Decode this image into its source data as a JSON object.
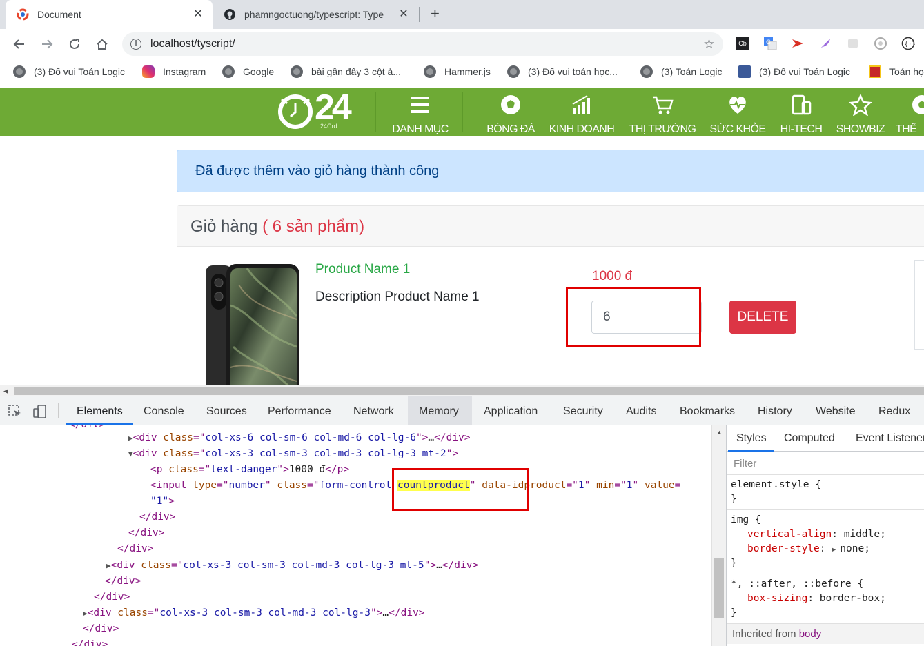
{
  "browser": {
    "tabs": [
      {
        "title": "Document",
        "active": true
      },
      {
        "title": "phamngoctuong/typescript: Type",
        "active": false
      }
    ],
    "url": "localhost/tyscript/",
    "bookmarks": [
      "(3) Đố vui Toán Logic",
      "Instagram",
      "Google",
      "bài gần đây 3 cột ả...",
      "Hammer.js",
      "(3) Đố vui toán học...",
      "(3) Toán Logic",
      "(3) Đố vui Toán Logic",
      "Toán họ"
    ],
    "extensions": [
      "Cb"
    ]
  },
  "site": {
    "logo_text": "24",
    "logo_sub": "24Crd",
    "nav": [
      "DANH MỤC",
      "BÓNG ĐÁ",
      "KINH DOANH",
      "THỊ TRƯỜNG",
      "SỨC KHỎE",
      "HI-TECH",
      "SHOWBIZ",
      "THỂ"
    ],
    "alert": "Đã được thêm vào giỏ hàng thành công",
    "cart": {
      "title": "Giỏ hàng",
      "count": "( 6 sản phẩm)",
      "product_name": "Product Name 1",
      "product_desc": "Description Product Name 1",
      "price": "1000 đ",
      "quantity": "6",
      "delete_label": "DELETE"
    }
  },
  "devtools": {
    "tabs": [
      "Elements",
      "Console",
      "Sources",
      "Performance",
      "Network",
      "Memory",
      "Application",
      "Security",
      "Audits",
      "Bookmarks",
      "History",
      "Website",
      "Redux"
    ],
    "elements": {
      "l0_cls": "col-xs-6 col-sm-6 col-md-6 col-lg-6",
      "l1_cls": "col-xs-3 col-sm-3 col-md-3 col-lg-3 mt-2",
      "l2_cls": "text-danger",
      "l2_text": "1000 đ",
      "l3_type": "number",
      "l3_cls_a": "form-control ",
      "l3_cls_b": "countproduct",
      "l3_data": "1",
      "l3_min": "1",
      "l4_val": "\"1\"",
      "l8_cls": "col-xs-3 col-sm-3 col-md-3 col-lg-3 mt-5",
      "l12_cls": "col-xs-3 col-sm-3 col-md-3 col-lg-3"
    },
    "styles": {
      "tabs": [
        "Styles",
        "Computed",
        "Event Listener"
      ],
      "filter_placeholder": "Filter",
      "rule1_selector": "element.style {",
      "rule2_selector": "img {",
      "rule2_p1_name": "vertical-align",
      "rule2_p1_value": "middle;",
      "rule2_p2_name": "border-style",
      "rule2_p2_value": "none;",
      "rule3_selector": "*, ::after, ::before {",
      "rule3_p1_name": "box-sizing",
      "rule3_p1_value": "border-box;",
      "inherited_label": "Inherited from",
      "inherited_from": "body"
    }
  }
}
